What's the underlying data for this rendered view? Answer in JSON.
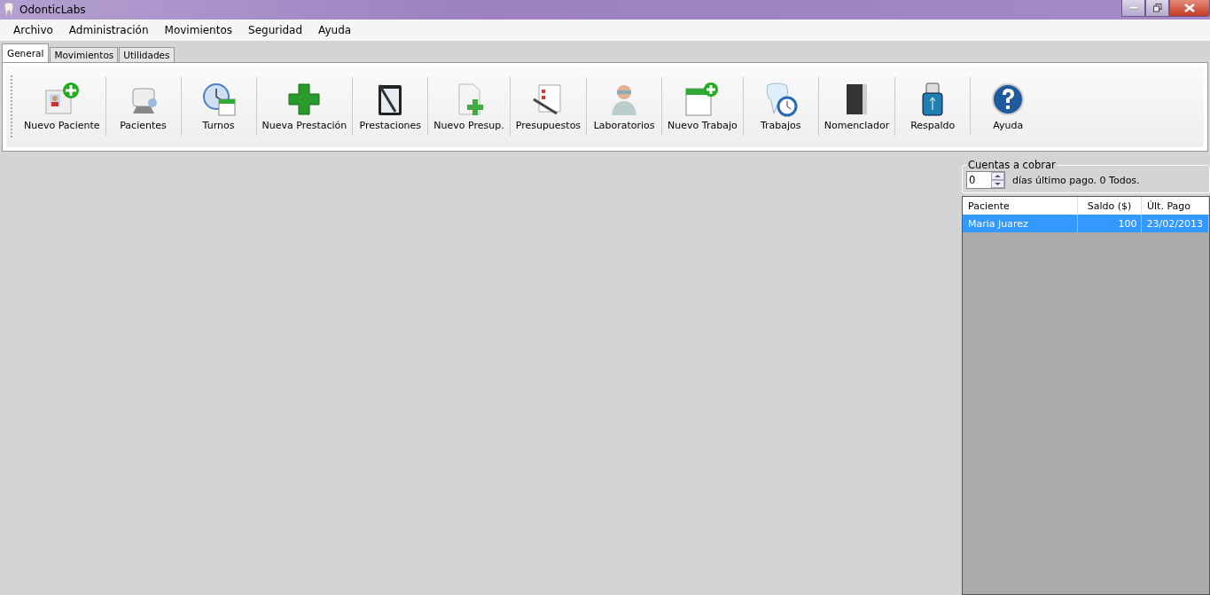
{
  "window": {
    "title": "OdonticLabs"
  },
  "menu": [
    "Archivo",
    "Administración",
    "Movimientos",
    "Seguridad",
    "Ayuda"
  ],
  "tabs": [
    {
      "label": "General",
      "selected": true
    },
    {
      "label": "Movimientos",
      "selected": false
    },
    {
      "label": "Utilidades",
      "selected": false
    }
  ],
  "toolbar": [
    {
      "label": "Nuevo Paciente"
    },
    {
      "label": "Pacientes"
    },
    {
      "label": "Turnos"
    },
    {
      "label": "Nueva Prestación"
    },
    {
      "label": "Prestaciones"
    },
    {
      "label": "Nuevo Presup."
    },
    {
      "label": "Presupuestos"
    },
    {
      "label": "Laboratorios"
    },
    {
      "label": "Nuevo Trabajo"
    },
    {
      "label": "Trabajos"
    },
    {
      "label": "Nomenclador"
    },
    {
      "label": "Respaldo"
    },
    {
      "label": "Ayuda"
    }
  ],
  "accounts": {
    "title": "Cuentas a cobrar",
    "days_value": "0",
    "days_hint": "días último pago. 0 Todos.",
    "columns": [
      "Paciente",
      "Saldo ($)",
      "Últ. Pago"
    ],
    "rows": [
      {
        "cells": [
          "Maria Juarez",
          "100",
          "23/02/2013"
        ],
        "selected": true
      }
    ]
  }
}
